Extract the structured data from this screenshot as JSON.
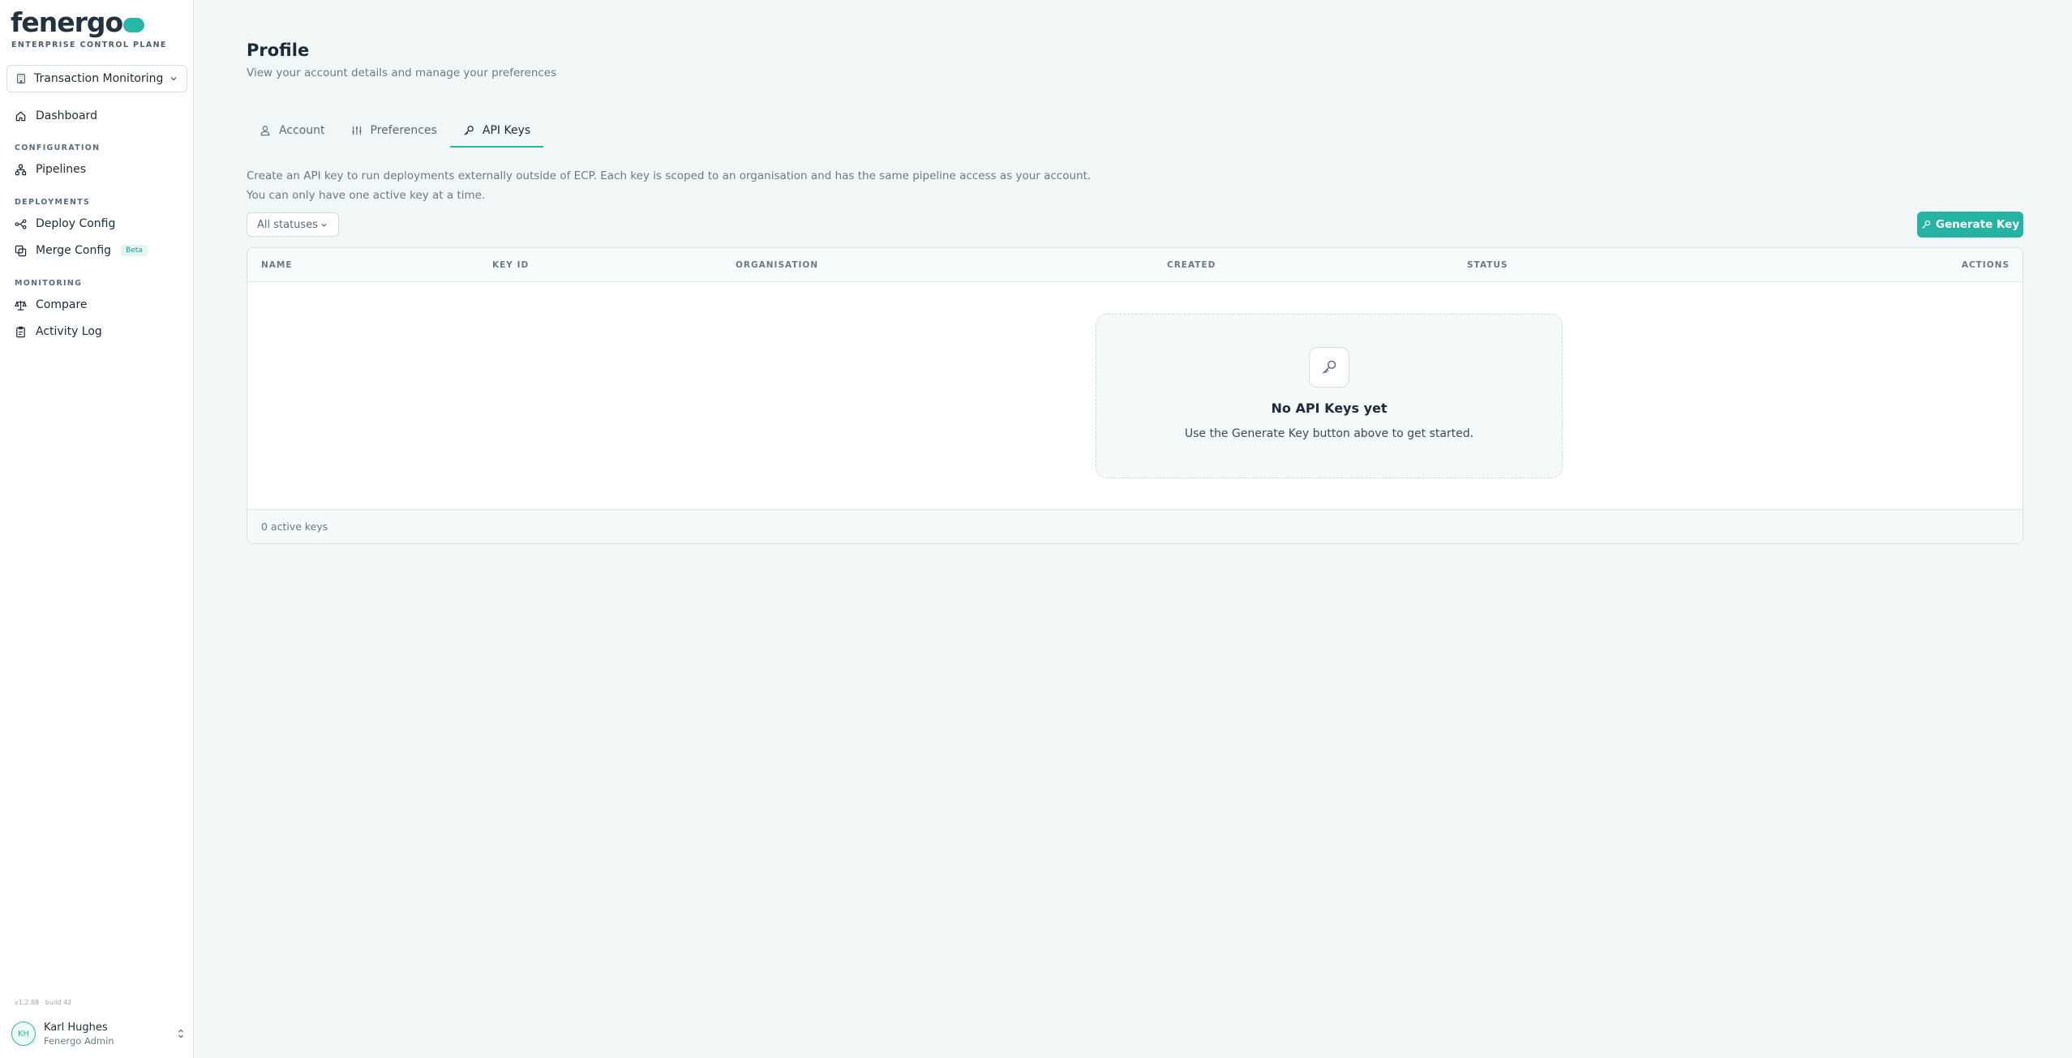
{
  "brand": {
    "logo_text": "fenergo",
    "subtitle": "ENTERPRISE CONTROL PLANE"
  },
  "workspace": {
    "label": "Transaction Monitoring"
  },
  "sidebar": {
    "items": [
      {
        "label": "Dashboard",
        "icon": "home-icon"
      },
      {
        "label": "Pipelines",
        "icon": "pipeline-icon"
      },
      {
        "label": "Deploy Config",
        "icon": "deploy-icon"
      },
      {
        "label": "Merge Config",
        "icon": "merge-icon",
        "badge": "Beta"
      },
      {
        "label": "Compare",
        "icon": "scale-icon"
      },
      {
        "label": "Activity Log",
        "icon": "clipboard-icon"
      }
    ],
    "sections": {
      "configuration": "CONFIGURATION",
      "deployments": "DEPLOYMENTS",
      "monitoring": "MONITORING"
    },
    "version": "v1.2.88 · build 42"
  },
  "user": {
    "initials": "KH",
    "name": "Karl Hughes",
    "role": "Fenergo Admin"
  },
  "page": {
    "title": "Profile",
    "subtitle": "View your account details and manage your preferences"
  },
  "tabs": [
    {
      "label": "Account",
      "icon": "user-icon",
      "active": false
    },
    {
      "label": "Preferences",
      "icon": "sliders-icon",
      "active": false
    },
    {
      "label": "API Keys",
      "icon": "key-icon",
      "active": true
    }
  ],
  "intro": {
    "line1": "Create an API key to run deployments externally outside of ECP. Each key is scoped to an organisation and has the same pipeline access as your account.",
    "line2": "You can only have one active key at a time."
  },
  "filter": {
    "label": "All statuses"
  },
  "actions": {
    "generate_label": "Generate Key"
  },
  "table": {
    "columns": [
      "NAME",
      "KEY ID",
      "ORGANISATION",
      "CREATED",
      "STATUS",
      "ACTIONS"
    ],
    "rows": [],
    "footer": "0 active keys"
  },
  "empty_state": {
    "title": "No API Keys yet",
    "text": "Use the Generate Key button above to get started."
  },
  "colors": {
    "accent": "#29b6a6",
    "background": "#f1f7f7",
    "text": "#1d2b36"
  }
}
